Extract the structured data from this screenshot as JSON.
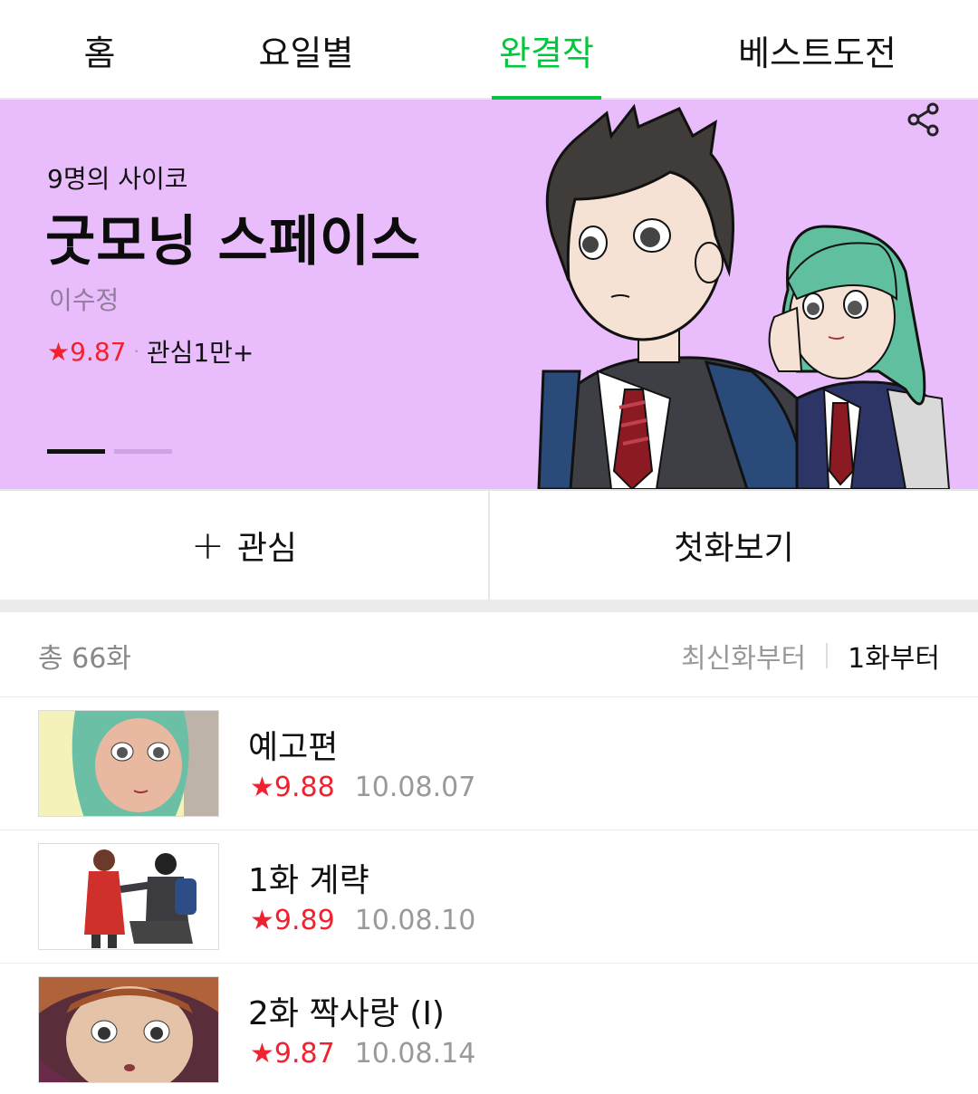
{
  "tabs": [
    {
      "label": "홈",
      "active": false
    },
    {
      "label": "요일별",
      "active": false
    },
    {
      "label": "완결작",
      "active": true
    },
    {
      "label": "베스트도전",
      "active": false
    }
  ],
  "hero": {
    "subtitle": "9명의 사이코",
    "title": "굿모닝 스페이스",
    "author": "이수정",
    "rating": "9.87",
    "interest": "관심1만+",
    "background_color": "#e9bdfb",
    "slides_current": 1,
    "slides_total": 2
  },
  "actions": {
    "subscribe_label": "관심",
    "first_episode_label": "첫화보기"
  },
  "list": {
    "total": "총 66화",
    "sort_latest": "최신화부터",
    "sort_first": "1화부터",
    "episodes": [
      {
        "title": "예고편",
        "rating": "9.88",
        "date": "10.08.07"
      },
      {
        "title": "1화 계략",
        "rating": "9.89",
        "date": "10.08.10"
      },
      {
        "title": "2화 짝사랑 (I)",
        "rating": "9.87",
        "date": "10.08.14"
      }
    ]
  },
  "colors": {
    "accent": "#00c73c",
    "rating_red": "#f0222f"
  }
}
